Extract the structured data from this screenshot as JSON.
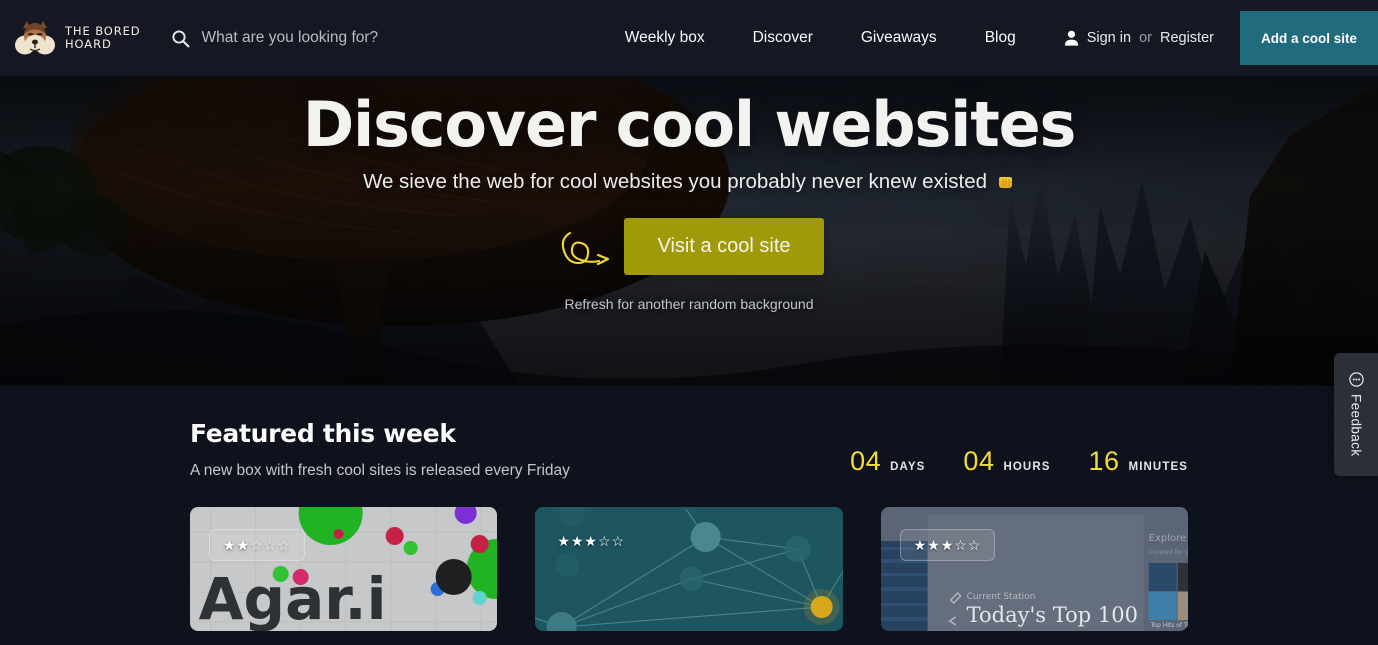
{
  "header": {
    "brand": {
      "line1": "The Bored",
      "line2": "Hoard",
      "logo_icon": "chipmunk-mascot-icon"
    },
    "search": {
      "icon": "search-icon",
      "placeholder": "What are you looking for?",
      "value": ""
    },
    "nav": [
      {
        "label": "Weekly box"
      },
      {
        "label": "Discover"
      },
      {
        "label": "Giveaways"
      },
      {
        "label": "Blog"
      }
    ],
    "account": {
      "icon": "person-icon",
      "signin": "Sign in",
      "or": "or",
      "register": "Register"
    },
    "cta": {
      "label": "Add a cool site",
      "color": "#216b7e"
    }
  },
  "hero": {
    "title": "Discover cool websites",
    "subtitle": "We sieve the web for cool websites you probably never knew existed",
    "emoji": "fist-bump-emoji",
    "doodle": "curly-arrow-doodle",
    "button": {
      "label": "Visit a cool site",
      "color": "#a09a0b"
    },
    "note": "Refresh for another random background",
    "background_alt": "dark fantasy landscape with giant mushroom canopy and mountain spires"
  },
  "featured": {
    "title": "Featured this week",
    "description": "A new box with fresh cool sites is released every Friday",
    "countdown": [
      {
        "value": "04",
        "label": "DAYS"
      },
      {
        "value": "04",
        "label": "HOURS"
      },
      {
        "value": "16",
        "label": "MINUTES"
      }
    ],
    "countdown_color": "#f2dc36",
    "cards": [
      {
        "name": "agar-io",
        "rating": 2,
        "rating_max": 5,
        "rating_style": "pill",
        "thumbnail_text": "Agar.io",
        "thumbnail_alt": "Agar.io game board with colored cells on light grid"
      },
      {
        "name": "network-graph-site",
        "rating": 3,
        "rating_max": 5,
        "rating_style": "plain",
        "thumbnail_text": "",
        "thumbnail_alt": "teal network graph with connected nodes and one yellow node"
      },
      {
        "name": "radio-station-site",
        "rating": 3,
        "rating_max": 5,
        "rating_style": "pill",
        "thumbnail_text": "Today's Top 100",
        "thumbnail_labels": [
          "Current Station",
          "Today's Top 100",
          "Explore Stations",
          "Top Hits of Today"
        ],
        "thumbnail_alt": "music streaming app showing current station and album art grid"
      }
    ]
  },
  "feedback": {
    "label": "Feedback",
    "icon": "speech-bubble-icon"
  },
  "stars": {
    "filled": "★",
    "empty": "☆"
  }
}
